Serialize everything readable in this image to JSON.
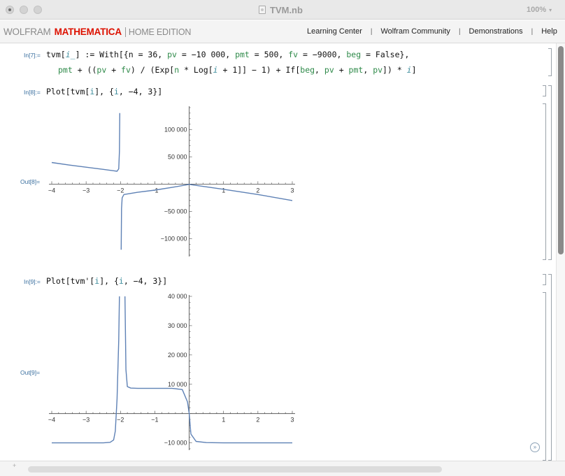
{
  "window": {
    "title": "TVM.nb",
    "zoom": "100%"
  },
  "header": {
    "brand_wolfram": "WOLFRAM",
    "brand_mathematica": "MATHEMATICA",
    "brand_edition": "HOME EDITION",
    "links": [
      "Learning Center",
      "Wolfram Community",
      "Demonstrations",
      "Help"
    ],
    "separator": "|"
  },
  "cells": {
    "in7_label": "In[7]:=",
    "in7_line1": {
      "a": "tvm[",
      "b": "i_",
      "c": "] := With[{n = 36, ",
      "d": "pv",
      "e": " = −10 000, ",
      "f": "pmt",
      "g": " = 500, ",
      "h": "fv",
      "i": " = −9000, ",
      "j": "beg",
      "k": " = False},"
    },
    "in7_line2": {
      "a": "pmt",
      "b": " + ((",
      "c": "pv",
      "d": " + ",
      "e": "fv",
      "f": ") / (Exp[",
      "g": "n",
      "h": " * Log[",
      "i": "i",
      "j": " + 1]] − 1) + If[",
      "k": "beg",
      "l": ", ",
      "m": "pv",
      "n": " + ",
      "o": "pmt",
      "p": ", ",
      "q": "pv",
      "r": "]) * ",
      "s": "i",
      "t": "]"
    },
    "in8_label": "In[8]:=",
    "in8_code": {
      "a": "Plot[tvm[",
      "b": "i",
      "c": "], {",
      "d": "i",
      "e": ", −4, 3}]"
    },
    "out8_label": "Out[8]=",
    "in9_label": "In[9]:=",
    "in9_code": {
      "a": "Plot[tvm'[",
      "b": "i",
      "c": "], {",
      "d": "i",
      "e": ", −4, 3}]"
    },
    "out9_label": "Out[9]="
  },
  "colors": {
    "curve": "#5e81b5",
    "label": "#3a6f9f",
    "green_var": "#2f8a4a",
    "teal_var": "#3c8c9c",
    "brand_red": "#dd1100"
  },
  "chart_data": [
    {
      "type": "line",
      "xlim": [
        -4,
        3
      ],
      "ylim": [
        -130000,
        140000
      ],
      "x_ticks": [
        -4,
        -3,
        -2,
        -1,
        1,
        2,
        3
      ],
      "x_tick_labels": [
        "−4",
        "−3",
        "−2",
        "−1",
        "1",
        "2",
        "3"
      ],
      "y_ticks": [
        100000,
        50000,
        -50000,
        -100000
      ],
      "y_tick_labels": [
        "100 000",
        "50 000",
        "−50 000",
        "−100 000"
      ],
      "series": [
        {
          "values_x": [
            -4,
            -3.5,
            -3,
            -2.5,
            -2.2,
            -2.1,
            -2.05,
            -2.03,
            -2.02
          ],
          "values_y": [
            39500,
            35000,
            31000,
            27000,
            24500,
            23500,
            28000,
            60000,
            130000
          ]
        },
        {
          "values_x": [
            -1.98,
            -1.97,
            -1.95,
            -1.9,
            -1.5,
            -1,
            -0.5,
            0,
            0.5,
            1,
            2,
            3
          ],
          "values_y": [
            -120000,
            -45000,
            -25000,
            -19000,
            -15000,
            -11000,
            -6000,
            -500,
            -5000,
            -9500,
            -19000,
            -30000
          ]
        }
      ]
    },
    {
      "type": "line",
      "xlim": [
        -4,
        3
      ],
      "ylim": [
        -12000,
        40000
      ],
      "x_ticks": [
        -4,
        -3,
        -2,
        -1,
        1,
        2,
        3
      ],
      "x_tick_labels": [
        "−4",
        "−3",
        "−2",
        "−1",
        "1",
        "2",
        "3"
      ],
      "y_ticks": [
        40000,
        30000,
        20000,
        10000,
        -10000
      ],
      "y_tick_labels": [
        "40 000",
        "30 000",
        "20 000",
        "10 000",
        "−10 000"
      ],
      "series": [
        {
          "values_x": [
            -4,
            -3,
            -2.5,
            -2.3,
            -2.2,
            -2.15,
            -2.1,
            -2.05,
            -2.03
          ],
          "values_y": [
            -10000,
            -10000,
            -10000,
            -9800,
            -9000,
            -6000,
            5000,
            25000,
            40000
          ]
        },
        {
          "values_x": [
            -1.87,
            -1.84,
            -1.8,
            -1.7,
            -1.5,
            -1,
            -0.5,
            -0.2,
            -0.05,
            0,
            0.05,
            0.2,
            0.5,
            1,
            2,
            3
          ],
          "values_y": [
            40000,
            15000,
            9200,
            8700,
            8600,
            8600,
            8600,
            8200,
            4000,
            0,
            -7000,
            -9500,
            -9900,
            -10000,
            -10000,
            -10000
          ]
        }
      ]
    }
  ]
}
